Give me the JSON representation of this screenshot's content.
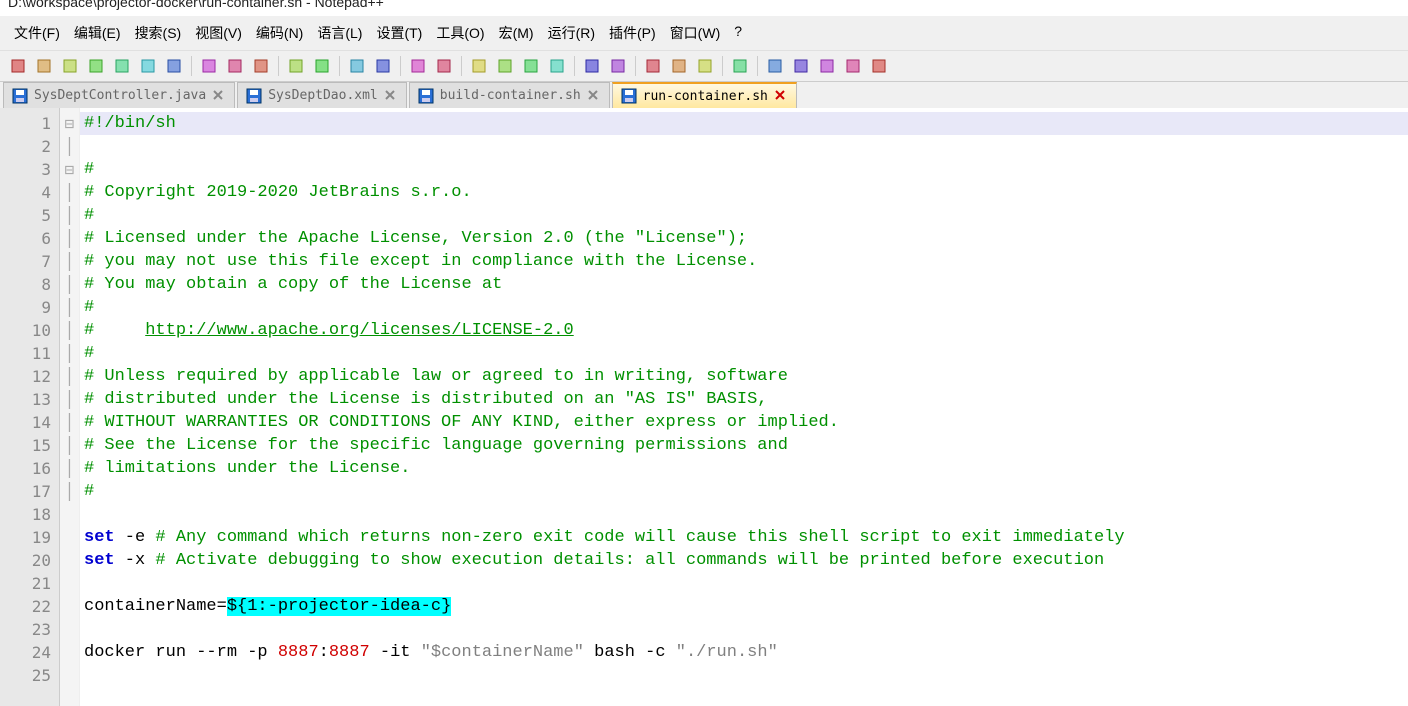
{
  "window": {
    "title": "D:\\workspace\\projector-docker\\run-container.sh - Notepad++"
  },
  "menu": {
    "items": [
      "文件(F)",
      "编辑(E)",
      "搜索(S)",
      "视图(V)",
      "编码(N)",
      "语言(L)",
      "设置(T)",
      "工具(O)",
      "宏(M)",
      "运行(R)",
      "插件(P)",
      "窗口(W)",
      "?"
    ]
  },
  "toolbar_icons": [
    "new-file-icon",
    "open-file-icon",
    "save-icon",
    "save-all-icon",
    "close-icon",
    "close-all-icon",
    "print-icon",
    "",
    "cut-icon",
    "copy-icon",
    "paste-icon",
    "",
    "undo-icon",
    "redo-icon",
    "",
    "find-icon",
    "replace-icon",
    "",
    "zoom-in-icon",
    "zoom-out-icon",
    "",
    "sync-v-icon",
    "sync-h-icon",
    "wrap-icon",
    "whitespace-icon",
    "",
    "indent-icon",
    "outdent-icon",
    "",
    "folder-icon",
    "function-list-icon",
    "doc-map-icon",
    "",
    "monitor-icon",
    "",
    "record-icon",
    "stop-icon",
    "play-icon",
    "play-multi-icon",
    "save-macro-icon"
  ],
  "tabs": [
    {
      "label": "SysDeptController.java",
      "active": false
    },
    {
      "label": "SysDeptDao.xml",
      "active": false
    },
    {
      "label": "build-container.sh",
      "active": false
    },
    {
      "label": "run-container.sh",
      "active": true
    }
  ],
  "editor": {
    "current_line": 1,
    "line_count": 25,
    "lines": [
      {
        "n": 1,
        "tokens": [
          {
            "t": "#!/bin/sh",
            "c": "comment"
          }
        ],
        "fold": "open"
      },
      {
        "n": 2,
        "tokens": []
      },
      {
        "n": 3,
        "tokens": [
          {
            "t": "#",
            "c": "comment"
          }
        ],
        "fold": "open"
      },
      {
        "n": 4,
        "tokens": [
          {
            "t": "# Copyright 2019-2020 JetBrains s.r.o.",
            "c": "comment"
          }
        ]
      },
      {
        "n": 5,
        "tokens": [
          {
            "t": "#",
            "c": "comment"
          }
        ]
      },
      {
        "n": 6,
        "tokens": [
          {
            "t": "# Licensed under the Apache License, Version 2.0 (the \"License\");",
            "c": "comment"
          }
        ]
      },
      {
        "n": 7,
        "tokens": [
          {
            "t": "# you may not use this file except in compliance with the License.",
            "c": "comment"
          }
        ]
      },
      {
        "n": 8,
        "tokens": [
          {
            "t": "# You may obtain a copy of the License at",
            "c": "comment"
          }
        ]
      },
      {
        "n": 9,
        "tokens": [
          {
            "t": "#",
            "c": "comment"
          }
        ]
      },
      {
        "n": 10,
        "tokens": [
          {
            "t": "#     ",
            "c": "comment"
          },
          {
            "t": "http://www.apache.org/licenses/LICENSE-2.0",
            "c": "link"
          }
        ]
      },
      {
        "n": 11,
        "tokens": [
          {
            "t": "#",
            "c": "comment"
          }
        ]
      },
      {
        "n": 12,
        "tokens": [
          {
            "t": "# Unless required by applicable law or agreed to in writing, software",
            "c": "comment"
          }
        ]
      },
      {
        "n": 13,
        "tokens": [
          {
            "t": "# distributed under the License is distributed on an \"AS IS\" BASIS,",
            "c": "comment"
          }
        ]
      },
      {
        "n": 14,
        "tokens": [
          {
            "t": "# WITHOUT WARRANTIES OR CONDITIONS OF ANY KIND, either express or implied.",
            "c": "comment"
          }
        ]
      },
      {
        "n": 15,
        "tokens": [
          {
            "t": "# See the License for the specific language governing permissions and",
            "c": "comment"
          }
        ]
      },
      {
        "n": 16,
        "tokens": [
          {
            "t": "# limitations under the License.",
            "c": "comment"
          }
        ]
      },
      {
        "n": 17,
        "tokens": [
          {
            "t": "#",
            "c": "comment"
          }
        ]
      },
      {
        "n": 18,
        "tokens": []
      },
      {
        "n": 19,
        "tokens": [
          {
            "t": "set",
            "c": "keyword"
          },
          {
            "t": " -e ",
            "c": "plain"
          },
          {
            "t": "# Any command which returns non-zero exit code will cause this shell script to exit immediately",
            "c": "comment"
          }
        ]
      },
      {
        "n": 20,
        "tokens": [
          {
            "t": "set",
            "c": "keyword"
          },
          {
            "t": " -x ",
            "c": "plain"
          },
          {
            "t": "# Activate debugging to show execution details: all commands will be printed before execution",
            "c": "comment"
          }
        ]
      },
      {
        "n": 21,
        "tokens": []
      },
      {
        "n": 22,
        "tokens": [
          {
            "t": "containerName=",
            "c": "plain"
          },
          {
            "t": "${1:-projector-idea-c}",
            "c": "hl"
          }
        ]
      },
      {
        "n": 23,
        "tokens": []
      },
      {
        "n": 24,
        "tokens": [
          {
            "t": "docker run --rm -p ",
            "c": "plain"
          },
          {
            "t": "8887",
            "c": "number"
          },
          {
            "t": ":",
            "c": "plain"
          },
          {
            "t": "8887",
            "c": "number"
          },
          {
            "t": " -it ",
            "c": "plain"
          },
          {
            "t": "\"$containerName\"",
            "c": "string"
          },
          {
            "t": " bash -c ",
            "c": "plain"
          },
          {
            "t": "\"./run.sh\"",
            "c": "string"
          }
        ]
      },
      {
        "n": 25,
        "tokens": []
      }
    ]
  }
}
